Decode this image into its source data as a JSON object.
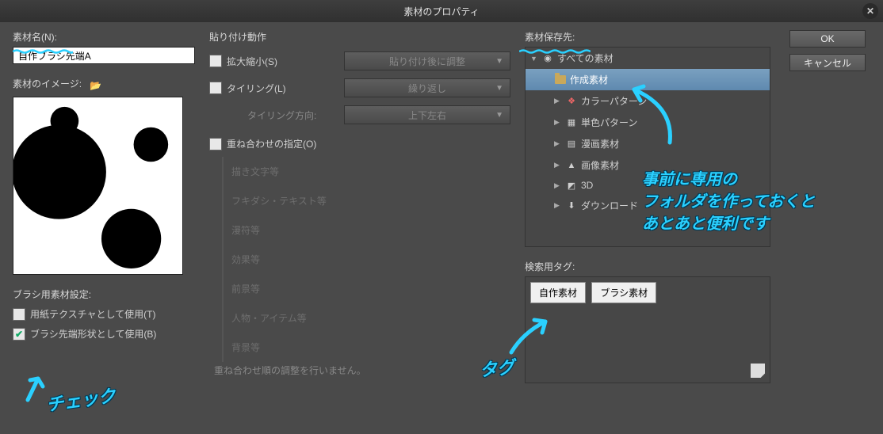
{
  "title": "素材のプロパティ",
  "left": {
    "name_label": "素材名(N):",
    "name_value": "自作ブラシ先端A",
    "image_label": "素材のイメージ:",
    "brush_settings_label": "ブラシ用素材設定:",
    "paper_checkbox": "用紙テクスチャとして使用(T)",
    "tip_checkbox": "ブラシ先端形状として使用(B)"
  },
  "mid": {
    "paste_label": "貼り付け動作",
    "scale_checkbox": "拡大縮小(S)",
    "scale_dropdown": "貼り付け後に調整",
    "tiling_checkbox": "タイリング(L)",
    "tiling_dropdown": "繰り返し",
    "tiling_dir_label": "タイリング方向:",
    "tiling_dir_dropdown": "上下左右",
    "overlay_checkbox": "重ね合わせの指定(O)",
    "overlay_items": [
      "描き文字等",
      "フキダシ・テキスト等",
      "漫符等",
      "効果等",
      "前景等",
      "人物・アイテム等",
      "背景等"
    ],
    "overlay_note": "重ね合わせ順の調整を行いません。"
  },
  "right": {
    "save_label": "素材保存先:",
    "tree": {
      "root": "すべての素材",
      "selected": "作成素材",
      "items": [
        "カラーパターン",
        "単色パターン",
        "漫画素材",
        "画像素材",
        "3D",
        "ダウンロード"
      ]
    },
    "tag_label": "検索用タグ:",
    "tags": [
      "自作素材",
      "ブラシ素材"
    ]
  },
  "buttons": {
    "ok": "OK",
    "cancel": "キャンセル"
  },
  "annotations": {
    "folder_note_1": "事前に専用の",
    "folder_note_2": "フォルダを作っておくと",
    "folder_note_3": "あとあと便利です",
    "tag_note": "タグ",
    "check_note": "チェック"
  }
}
